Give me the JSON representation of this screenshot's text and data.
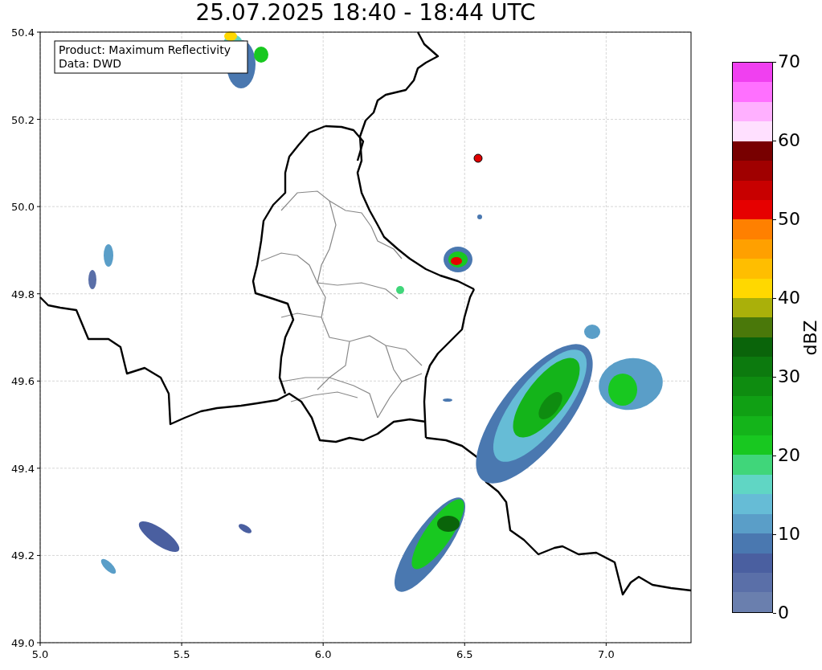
{
  "title": "25.07.2025 18:40 - 18:44 UTC",
  "map": {
    "legend": [
      "Product: Maximum Reflectivity",
      "Data: DWD"
    ],
    "x_ticks": [
      "5.0",
      "5.5",
      "6.0",
      "6.5",
      "7.0"
    ],
    "y_ticks": [
      "50.4",
      "50.2",
      "50.0",
      "49.8",
      "49.6",
      "49.4",
      "49.2",
      "49.0"
    ]
  },
  "colorbar": {
    "label": "dBZ",
    "ticks": [
      "70",
      "60",
      "50",
      "40",
      "30",
      "20",
      "10",
      "0"
    ],
    "bands": [
      {
        "color": "#f040f0"
      },
      {
        "color": "#ff70ff"
      },
      {
        "color": "#ffb0ff"
      },
      {
        "color": "#ffe0ff"
      },
      {
        "color": "#780000"
      },
      {
        "color": "#a00000"
      },
      {
        "color": "#c80000"
      },
      {
        "color": "#e60000"
      },
      {
        "color": "#ff8000"
      },
      {
        "color": "#ffa000"
      },
      {
        "color": "#ffbe00"
      },
      {
        "color": "#ffd800"
      },
      {
        "color": "#aab00a"
      },
      {
        "color": "#4a780a"
      },
      {
        "color": "#0a640a"
      },
      {
        "color": "#0c7a0e"
      },
      {
        "color": "#0e8c10"
      },
      {
        "color": "#10a014"
      },
      {
        "color": "#14b41a"
      },
      {
        "color": "#18c820"
      },
      {
        "color": "#40d67a"
      },
      {
        "color": "#60d6c4"
      },
      {
        "color": "#66bcd6"
      },
      {
        "color": "#5a9ec8"
      },
      {
        "color": "#4a78b0"
      },
      {
        "color": "#4a5fa0"
      },
      {
        "color": "#5a6fa8"
      },
      {
        "color": "#6a7fae"
      }
    ]
  }
}
